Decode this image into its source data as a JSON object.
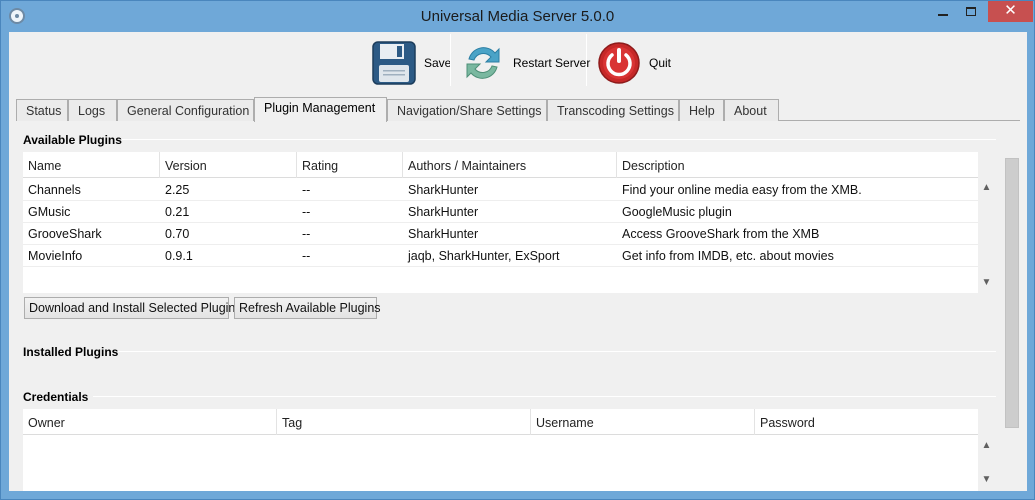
{
  "window": {
    "title": "Universal Media Server 5.0.0",
    "minimize_glyph": "",
    "close_glyph": "✕"
  },
  "toolbar": {
    "save_label": "Save",
    "restart_label": "Restart Server",
    "quit_label": "Quit"
  },
  "tabs": [
    {
      "label": "Status"
    },
    {
      "label": "Logs"
    },
    {
      "label": "General Configuration"
    },
    {
      "label": "Plugin Management"
    },
    {
      "label": "Navigation/Share Settings"
    },
    {
      "label": "Transcoding Settings"
    },
    {
      "label": "Help"
    },
    {
      "label": "About"
    }
  ],
  "available_plugins": {
    "title": "Available Plugins",
    "columns": [
      "Name",
      "Version",
      "Rating",
      "Authors / Maintainers",
      "Description"
    ],
    "rows": [
      {
        "name": "Channels",
        "version": "2.25",
        "rating": "--",
        "authors": "SharkHunter",
        "description": "Find your online media easy from the XMB."
      },
      {
        "name": "GMusic",
        "version": "0.21",
        "rating": "--",
        "authors": "SharkHunter",
        "description": "GoogleMusic plugin"
      },
      {
        "name": "GrooveShark",
        "version": "0.70",
        "rating": "--",
        "authors": "SharkHunter",
        "description": "Access GrooveShark from the XMB"
      },
      {
        "name": "MovieInfo",
        "version": "0.9.1",
        "rating": "--",
        "authors": "jaqb, SharkHunter, ExSport",
        "description": "Get info from IMDB, etc. about movies"
      }
    ],
    "download_button": "Download and Install Selected Plugin",
    "refresh_button": "Refresh Available Plugins"
  },
  "installed_plugins": {
    "title": "Installed Plugins"
  },
  "credentials": {
    "title": "Credentials",
    "columns": [
      "Owner",
      "Tag",
      "Username",
      "Password"
    ]
  },
  "colors": {
    "save_icon": "#2c5a85",
    "restart_icon": "#4aa3c7",
    "quit_icon": "#c62828",
    "close_button": "#c75050"
  },
  "icons": {
    "save": "floppy-disk-icon",
    "restart": "refresh-arrows-icon",
    "quit": "power-icon",
    "app": "app-logo-icon"
  }
}
